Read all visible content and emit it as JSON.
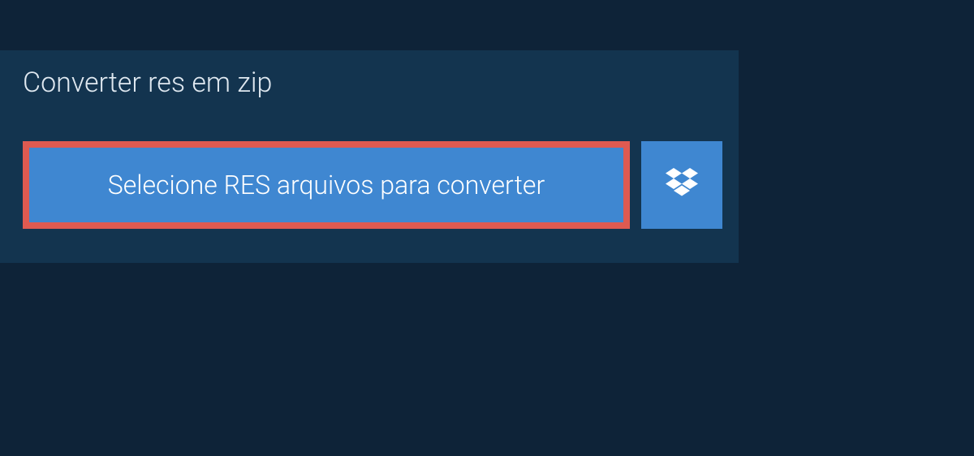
{
  "header": {
    "title": "Converter res em zip"
  },
  "actions": {
    "select_label": "Selecione RES arquivos para converter",
    "dropbox_icon": "dropbox-icon"
  },
  "colors": {
    "background": "#0e2338",
    "panel": "#13344f",
    "button": "#3f87d1",
    "highlight_border": "#de5a51",
    "text_light": "#ffffff"
  }
}
